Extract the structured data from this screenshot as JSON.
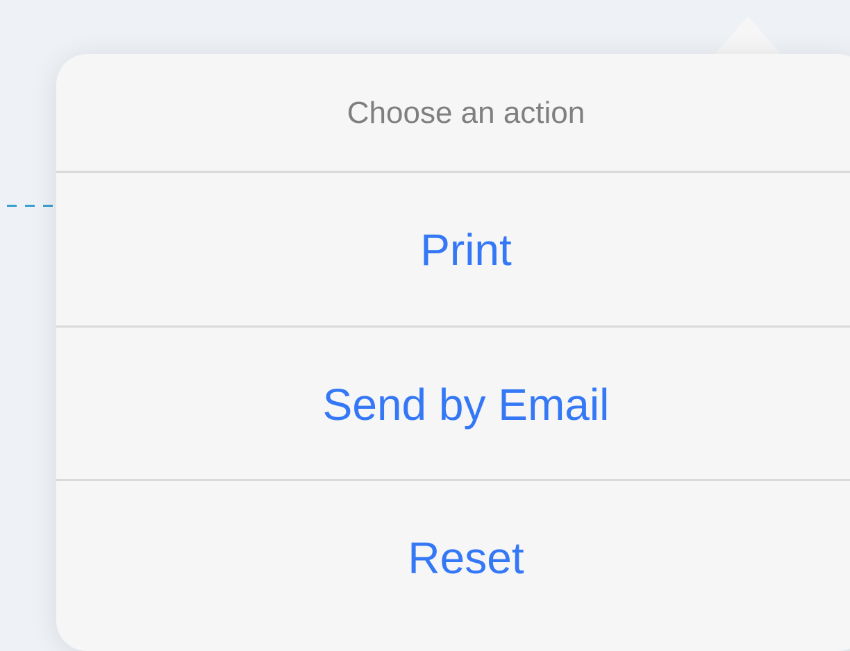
{
  "popover": {
    "title": "Choose an action",
    "actions": [
      {
        "label": "Print"
      },
      {
        "label": "Send by Email"
      },
      {
        "label": "Reset"
      }
    ]
  },
  "colors": {
    "background": "#eef2f6",
    "popover": "#f6f6f6",
    "action_text": "#3478f6",
    "title_text": "#7f7f7f",
    "divider": "#d9d9d9",
    "dashed_line": "#3aa0d0"
  }
}
